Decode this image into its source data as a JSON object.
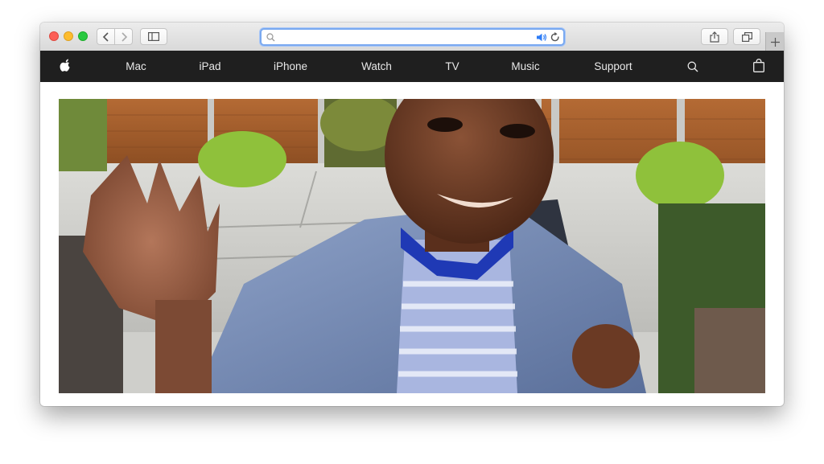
{
  "browser": {
    "address_bar": {
      "value": "",
      "placeholder": ""
    },
    "icons": {
      "back": "chevron-left-icon",
      "forward": "chevron-right-icon",
      "sidebar": "sidebar-icon",
      "search": "search-icon",
      "audio": "speaker-icon",
      "reload": "reload-icon",
      "share": "share-icon",
      "tabs": "tabs-icon",
      "new_tab": "plus-icon"
    },
    "accent_color": "#7aa9f0"
  },
  "nav": {
    "items": [
      {
        "label": "Mac"
      },
      {
        "label": "iPad"
      },
      {
        "label": "iPhone"
      },
      {
        "label": "Watch"
      },
      {
        "label": "TV"
      },
      {
        "label": "Music"
      },
      {
        "label": "Support"
      }
    ],
    "icons": {
      "logo": "apple-logo-icon",
      "search": "search-icon",
      "bag": "shopping-bag-icon"
    },
    "background": "#1f1f1f"
  },
  "hero": {
    "description_icon": "hero-video-frame",
    "content": "boy waving at camera"
  }
}
